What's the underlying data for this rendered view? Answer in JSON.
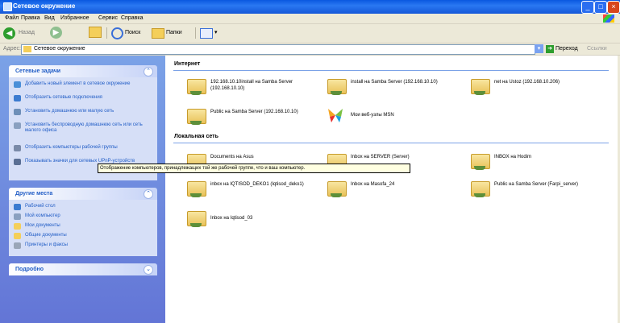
{
  "window": {
    "title": "Сетевое окружение"
  },
  "menu": [
    "Файл",
    "Правка",
    "Вид",
    "Избранное",
    "Сервис",
    "Справка"
  ],
  "toolbar": {
    "back": "Назад",
    "search": "Поиск",
    "folders": "Папки"
  },
  "address": {
    "label": "Адрес:",
    "value": "Сетевое окружение",
    "go": "Переход",
    "links": "Ссылки"
  },
  "sidebar": {
    "network_tasks": {
      "title": "Сетевые задачи",
      "items": [
        "Добавить новый элемент в сетевое окружение",
        "Отобразить сетевые подключения",
        "Установить домашнюю или малую сеть",
        "Установить беспроводную домашнюю сеть или сеть малого офиса",
        "Отобразить компьютеры рабочей группы",
        "Показывать значки для сетевых UPnP-устройств"
      ]
    },
    "other_places": {
      "title": "Другие места",
      "items": [
        "Рабочий стол",
        "Мой компьютер",
        "Мои документы",
        "Общие документы",
        "Принтеры и факсы"
      ]
    },
    "details": {
      "title": "Подробно"
    }
  },
  "groups": {
    "internet": "Интернет",
    "local": "Локальная сеть"
  },
  "items": {
    "internet": [
      "192.168.10.10install на Samba Server (192.168.10.10)",
      "install на Samba Server (192.168.10.10)",
      "net на Ustoz (192.168.10.206)",
      "Public на Samba Server (192.168.10.10)",
      "Мои веб-узлы MSN"
    ],
    "local": [
      "Documents на Asus",
      "Inbox на SERVER (Server)",
      "INBOX на Hodim",
      "inbox на IQTISOD_DEKO1 (Iqtisod_deko1)",
      "Inbox на Masofa_24",
      "Public на Samba Server (Farpi_server)",
      "Inbox на Iqtisod_03"
    ]
  },
  "tooltip": "Отображение компьютеров, принадлежащих той же рабочей группе, что и ваш компьютер."
}
